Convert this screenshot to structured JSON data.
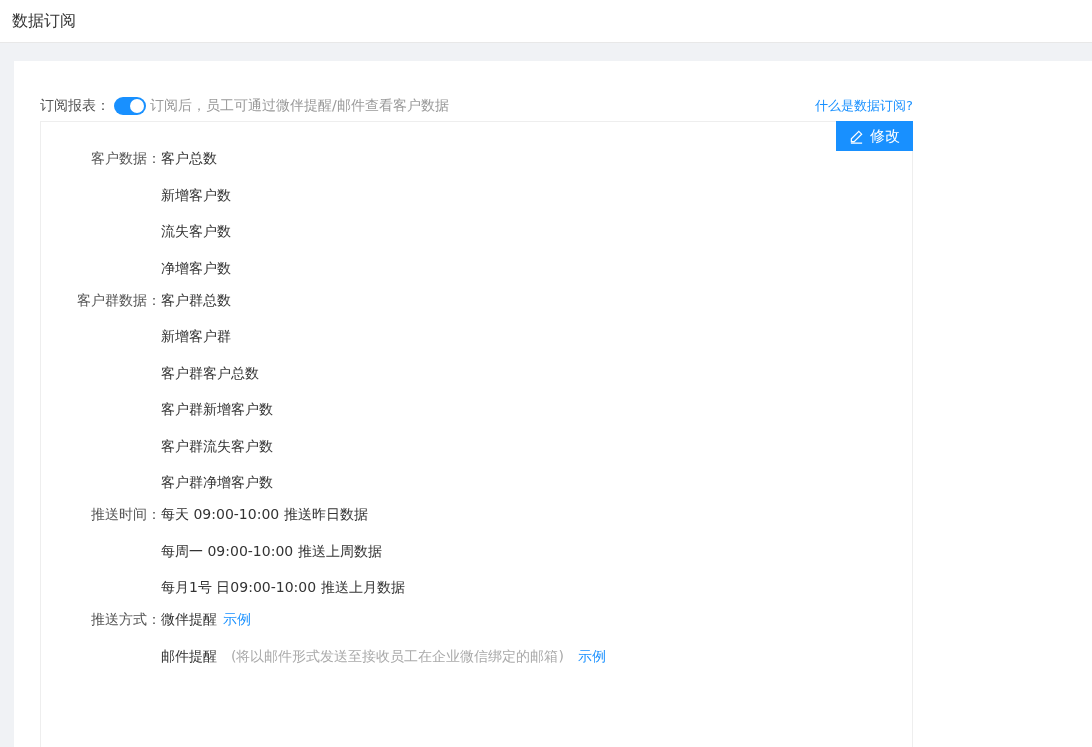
{
  "page_title": "数据订阅",
  "subscribe": {
    "label": "订阅报表：",
    "on": true,
    "hint": "订阅后，员工可通过微伴提醒/邮件查看客户数据",
    "help_link": "什么是数据订阅?"
  },
  "edit_button": "修改",
  "sections": [
    {
      "label": "客户数据：",
      "items": [
        {
          "text": "客户总数"
        },
        {
          "text": "新增客户数"
        },
        {
          "text": "流失客户数"
        },
        {
          "text": "净增客户数"
        }
      ]
    },
    {
      "label": "客户群数据：",
      "items": [
        {
          "text": "客户群总数"
        },
        {
          "text": "新增客户群"
        },
        {
          "text": "客户群客户总数"
        },
        {
          "text": "客户群新增客户数"
        },
        {
          "text": "客户群流失客户数"
        },
        {
          "text": "客户群净增客户数"
        }
      ]
    },
    {
      "label": "推送时间：",
      "items": [
        {
          "text": "每天 09:00-10:00 推送昨日数据"
        },
        {
          "text": "每周一 09:00-10:00 推送上周数据"
        },
        {
          "text": "每月1号 日09:00-10:00 推送上月数据"
        }
      ]
    },
    {
      "label": "推送方式：",
      "items": [
        {
          "text": "微伴提醒",
          "link": "示例"
        },
        {
          "text": "邮件提醒",
          "note": "(将以邮件形式发送至接收员工在企业微信绑定的邮箱)",
          "link": "示例"
        }
      ]
    }
  ]
}
